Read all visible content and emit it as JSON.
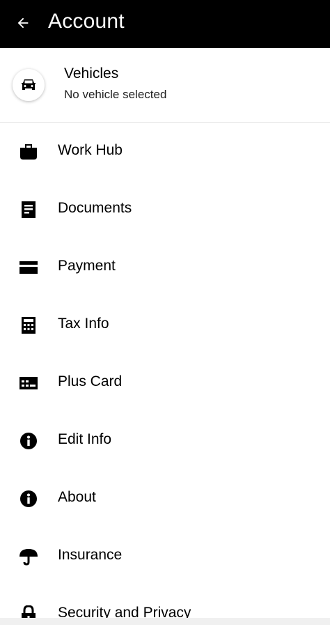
{
  "header": {
    "title": "Account",
    "back_icon": "arrow-left-icon"
  },
  "vehicle": {
    "title": "Vehicles",
    "subtitle": "No vehicle selected",
    "icon": "car-icon"
  },
  "menu": {
    "items": [
      {
        "label": "Work Hub",
        "icon": "briefcase-icon"
      },
      {
        "label": "Documents",
        "icon": "document-icon"
      },
      {
        "label": "Payment",
        "icon": "credit-card-icon"
      },
      {
        "label": "Tax Info",
        "icon": "calculator-icon"
      },
      {
        "label": "Plus Card",
        "icon": "plus-card-icon"
      },
      {
        "label": "Edit Info",
        "icon": "info-icon"
      },
      {
        "label": "About",
        "icon": "info-icon"
      },
      {
        "label": "Insurance",
        "icon": "umbrella-icon"
      },
      {
        "label": "Security and Privacy",
        "icon": "lock-icon"
      }
    ]
  },
  "colors": {
    "header_bg": "#000000",
    "header_text": "#ffffff",
    "page_bg": "#ffffff",
    "divider": "#e6e6e6"
  }
}
